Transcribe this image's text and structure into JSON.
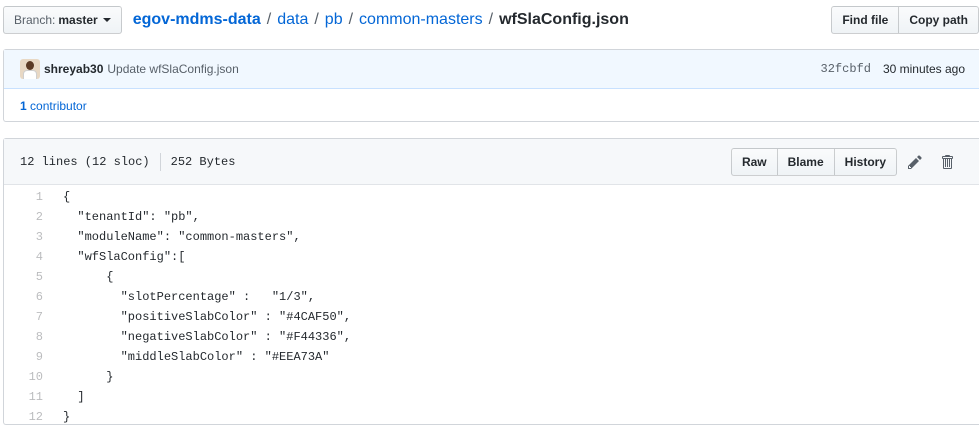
{
  "branch": {
    "label": "Branch:",
    "name": "master"
  },
  "breadcrumb": {
    "repo": "egov-mdms-data",
    "parts": [
      "data",
      "pb",
      "common-masters"
    ],
    "separator": "/",
    "file": "wfSlaConfig.json"
  },
  "header_buttons": {
    "find_file": "Find file",
    "copy_path": "Copy path"
  },
  "commit": {
    "author": "shreyab30",
    "message": "Update wfSlaConfig.json",
    "sha": "32fcbfd",
    "time": "30 minutes ago"
  },
  "contributors": {
    "count": "1",
    "label": "contributor"
  },
  "file": {
    "lines": "12 lines (12 sloc)",
    "size": "252 Bytes",
    "buttons": {
      "raw": "Raw",
      "blame": "Blame",
      "history": "History"
    },
    "icons": {
      "edit": "pencil-icon",
      "delete": "trash-icon"
    }
  },
  "code_lines": [
    "{",
    "  \"tenantId\": \"pb\",",
    "  \"moduleName\": \"common-masters\",",
    "  \"wfSlaConfig\":[",
    "      {",
    "        \"slotPercentage\" :   \"1/3\",",
    "        \"positiveSlabColor\" : \"#4CAF50\",",
    "        \"negativeSlabColor\" : \"#F44336\",",
    "        \"middleSlabColor\" : \"#EEA73A\"",
    "      }",
    "  ]",
    "}"
  ],
  "colors": {
    "link": "#0366d6",
    "commit_bg": "#f1f8ff",
    "header_bg": "#f6f8fa",
    "border": "#d1d5da"
  }
}
